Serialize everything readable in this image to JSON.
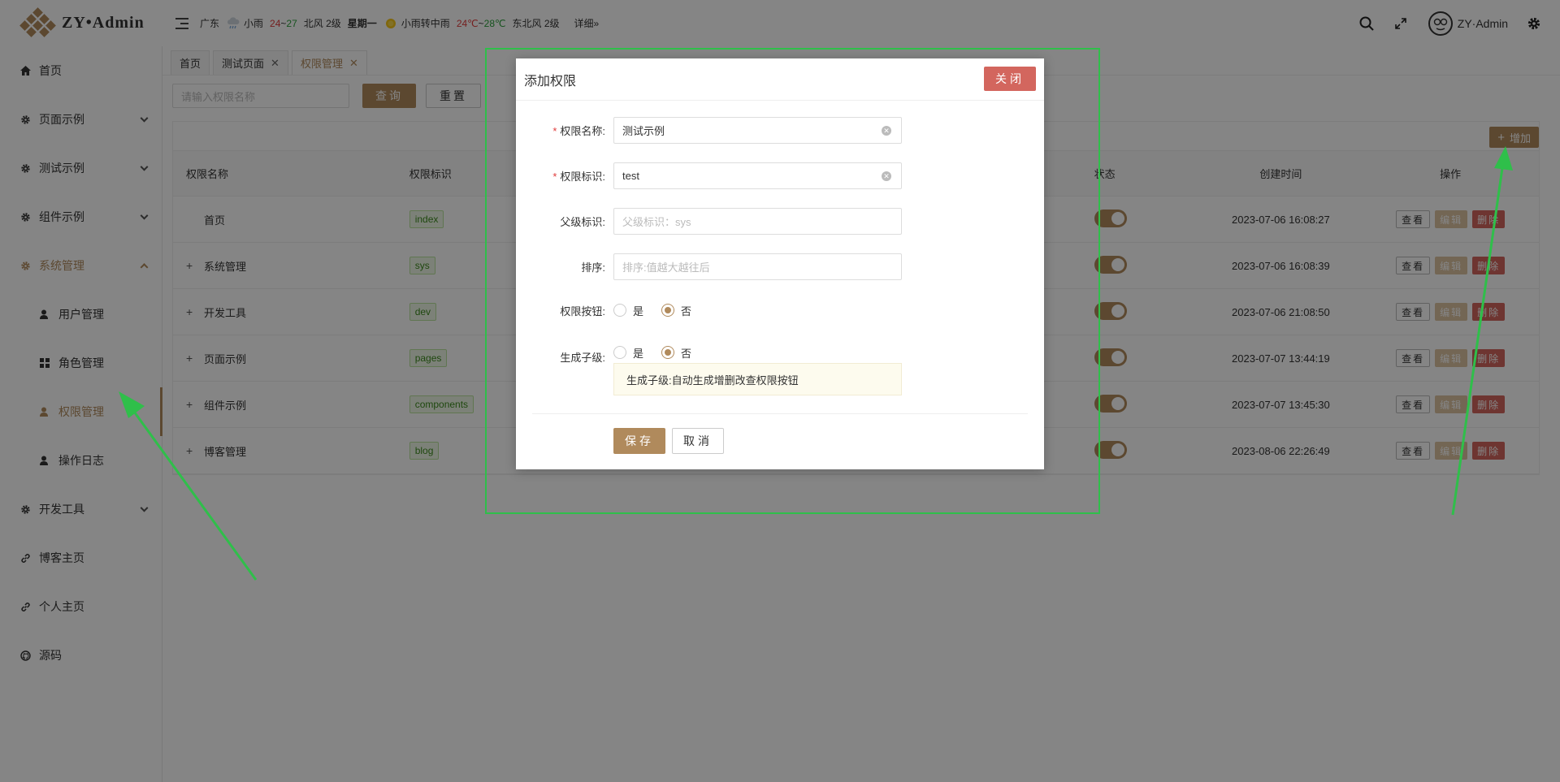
{
  "app": {
    "logo_text": "ZY•Admin"
  },
  "header": {
    "weather": {
      "location": "广东",
      "today_condition": "小雨",
      "today_hi": "24",
      "today_sep": "~",
      "today_lo": "27",
      "today_wind": "北风 2级",
      "weekday": "星期一",
      "tomorrow_condition": "小雨转中雨",
      "tomorrow_hi": "24℃",
      "tomorrow_sep": "~",
      "tomorrow_lo": "28℃",
      "tomorrow_wind": "东北风 2级",
      "detail_link": "详细»"
    },
    "username": "ZY·Admin",
    "icons": [
      "search-icon",
      "fullscreen-icon",
      "gear-icon"
    ]
  },
  "sidebar": {
    "items": [
      {
        "label": "首页",
        "icon": "home-icon"
      },
      {
        "label": "页面示例",
        "icon": "gear-icon"
      },
      {
        "label": "测试示例",
        "icon": "gear-icon"
      },
      {
        "label": "组件示例",
        "icon": "gear-icon"
      },
      {
        "label": "系统管理",
        "icon": "gear-icon"
      },
      {
        "label": "开发工具",
        "icon": "gear-icon"
      },
      {
        "label": "博客主页",
        "icon": "link-icon"
      },
      {
        "label": "个人主页",
        "icon": "link-icon"
      },
      {
        "label": "源码",
        "icon": "github-icon"
      }
    ],
    "sub_items": [
      {
        "label": "用户管理",
        "icon": "user-icon"
      },
      {
        "label": "角色管理",
        "icon": "grid-icon"
      },
      {
        "label": "权限管理",
        "icon": "user-icon"
      },
      {
        "label": "操作日志",
        "icon": "user-icon"
      }
    ]
  },
  "tabs": [
    {
      "label": "首页"
    },
    {
      "label": "测试页面",
      "close": "✕"
    },
    {
      "label": "权限管理",
      "close": "✕"
    }
  ],
  "toolbar": {
    "search_placeholder": "请输入权限名称",
    "query_label": "查询",
    "reset_label": "重置",
    "add_label": "增加",
    "add_icon": "+"
  },
  "table": {
    "headers": {
      "name": "权限名称",
      "code": "权限标识",
      "status": "状态",
      "time": "创建时间",
      "op": "操作"
    },
    "rows": [
      {
        "expand": "",
        "name": "首页",
        "code": "index",
        "time": "2023-07-06 16:08:27"
      },
      {
        "expand": "+",
        "name": "系统管理",
        "code": "sys",
        "time": "2023-07-06 16:08:39"
      },
      {
        "expand": "+",
        "name": "开发工具",
        "code": "dev",
        "time": "2023-07-06 21:08:50"
      },
      {
        "expand": "+",
        "name": "页面示例",
        "code": "pages",
        "time": "2023-07-07 13:44:19"
      },
      {
        "expand": "+",
        "name": "组件示例",
        "code": "components",
        "time": "2023-07-07 13:45:30"
      },
      {
        "expand": "+",
        "name": "博客管理",
        "code": "blog",
        "time": "2023-08-06 22:26:49"
      }
    ],
    "ops": {
      "view": "查看",
      "edit": "编辑",
      "delete": "删除"
    }
  },
  "modal": {
    "title": "添加权限",
    "close_label": "关闭",
    "required_mark": "*",
    "fields": {
      "name_label": "权限名称:",
      "name_value": "测试示例",
      "code_label": "权限标识:",
      "code_value": "test",
      "parent_label": "父级标识:",
      "parent_placeholder": "父级标识：sys",
      "sort_label": "排序:",
      "sort_placeholder": "排序:值越大越往后",
      "button_label": "权限按钮:",
      "child_label": "生成子级:",
      "yes": "是",
      "no": "否",
      "button_selected": "否",
      "child_selected": "否"
    },
    "tip": "生成子级:自动生成增删改查权限按钮",
    "save_label": "保存",
    "cancel_label": "取消"
  },
  "colors": {
    "accent": "#b08a5c",
    "danger": "#d3665e",
    "annotation": "#2fbf4a"
  }
}
